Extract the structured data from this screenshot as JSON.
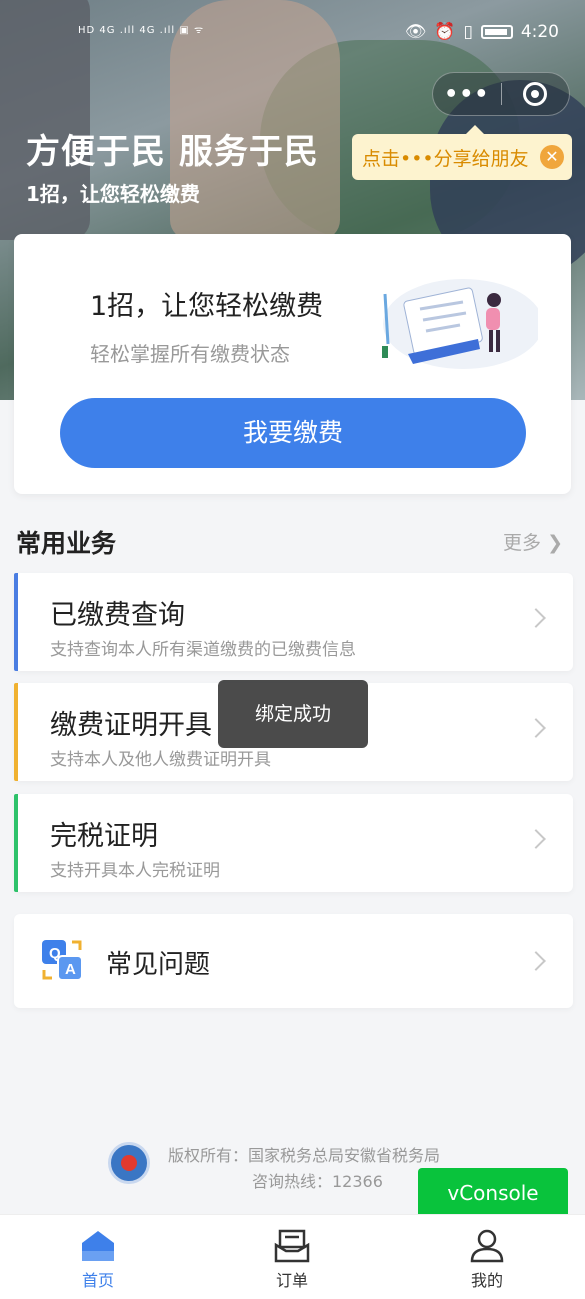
{
  "statusbar": {
    "left_indicators": "HD 4G .ıll 4G .ıll ▣ ᯤ",
    "time": "4:20"
  },
  "capsule": {
    "menu_label": "•••"
  },
  "share_tip": {
    "text": "点击•••分享给朋友",
    "close": "✕"
  },
  "hero": {
    "title": "方便于民 服务于民",
    "subtitle": "1招，让您轻松缴费"
  },
  "pay_card": {
    "title": "1招，让您轻松缴费",
    "desc": "轻松掌握所有缴费状态",
    "button": "我要缴费"
  },
  "section": {
    "title": "常用业务",
    "more": "更多"
  },
  "services": [
    {
      "title": "已缴费查询",
      "desc": "支持查询本人所有渠道缴费的已缴费信息",
      "accent": "#4a7de2"
    },
    {
      "title": "缴费证明开具",
      "desc": "支持本人及他人缴费证明开具",
      "accent": "#f0b130"
    },
    {
      "title": "完税证明",
      "desc": "支持开具本人完税证明",
      "accent": "#2ec26a"
    }
  ],
  "faq": {
    "title": "常见问题"
  },
  "toast": {
    "text": "绑定成功"
  },
  "footer": {
    "copyright": "版权所有：国家税务总局安徽省税务局",
    "hotline": "咨询热线：12366"
  },
  "vconsole": {
    "label": "vConsole"
  },
  "tabs": [
    {
      "label": "首页",
      "icon": "home-icon"
    },
    {
      "label": "订单",
      "icon": "order-icon"
    },
    {
      "label": "我的",
      "icon": "user-icon"
    }
  ]
}
